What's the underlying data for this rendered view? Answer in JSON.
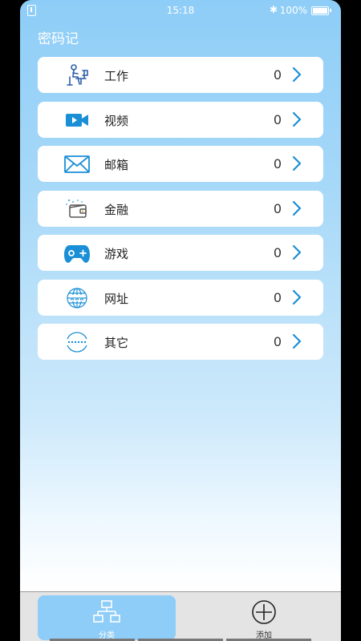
{
  "status_bar": {
    "time": "15:18",
    "battery": "100%"
  },
  "app": {
    "title": "密码记"
  },
  "categories": [
    {
      "label": "工作",
      "count": "0",
      "icon": "worker-at-desk-icon"
    },
    {
      "label": "视频",
      "count": "0",
      "icon": "video-camera-icon"
    },
    {
      "label": "邮箱",
      "count": "0",
      "icon": "envelope-icon"
    },
    {
      "label": "金融",
      "count": "0",
      "icon": "wallet-icon"
    },
    {
      "label": "游戏",
      "count": "0",
      "icon": "gamepad-icon"
    },
    {
      "label": "网址",
      "count": "0",
      "icon": "globe-www-icon"
    },
    {
      "label": "其它",
      "count": "0",
      "icon": "dots-circle-icon"
    }
  ],
  "tab_bar": {
    "category_label": "分类",
    "add_label": "添加",
    "active_tab": "分类"
  },
  "colors": {
    "accent": "#8ecdf7",
    "icon_blue": "#1a8fd6",
    "chevron": "#1a8fd6"
  }
}
